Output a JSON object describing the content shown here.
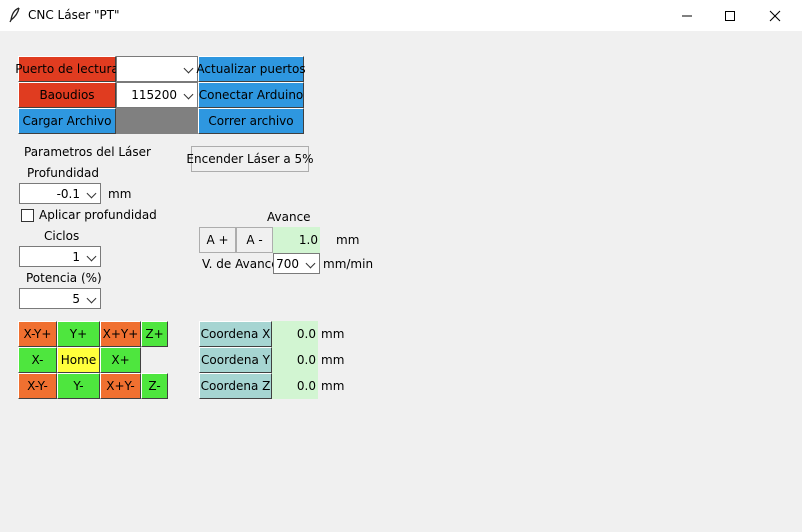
{
  "window": {
    "title": "CNC Láser \"PT\"",
    "icon": "feather-icon",
    "controls": [
      "minimize-icon",
      "maximize-icon",
      "close-icon"
    ]
  },
  "serial": {
    "port_label": "Puerto de lectura",
    "port_value": "",
    "baud_label": "Baoudios",
    "baud_value": "115200",
    "refresh_button": "Actualizar puertos",
    "connect_button": "Conectar Arduino",
    "load_file_button": "Cargar Archivo",
    "run_file_button": "Correr archivo"
  },
  "laser": {
    "params_title": "Parametros del Láser",
    "depth_label": "Profundidad",
    "depth_value": "-0.1",
    "depth_unit": "mm",
    "apply_depth_label": "Aplicar profundidad",
    "apply_depth_checked": false,
    "cycles_label": "Ciclos",
    "cycles_value": "1",
    "power_label": "Potencia (%)",
    "power_value": "5",
    "power_on_button": "Encender Láser a 5%"
  },
  "feed": {
    "title": "Avance",
    "increase_button": "A +",
    "decrease_button": "A -",
    "step_value": "1.0",
    "step_unit": "mm",
    "speed_label": "V. de Avance",
    "speed_value": "700",
    "speed_unit": "mm/min"
  },
  "jog": {
    "xm_yp": "X-Y+",
    "yp": "Y+",
    "xp_yp": "X+Y+",
    "zp": "Z+",
    "xm": "X-",
    "home": "Home",
    "xp": "X+",
    "xm_ym": "X-Y-",
    "ym": "Y-",
    "xp_ym": "X+Y-",
    "zm": "Z-"
  },
  "coords": {
    "x_label": "Coordena X",
    "x_value": "0.0",
    "y_label": "Coordena Y",
    "y_value": "0.0",
    "z_label": "Coordena Z",
    "z_value": "0.0",
    "unit": "mm"
  },
  "colors": {
    "red": "#e03c20",
    "blue": "#2e97e0",
    "orange": "#f07030",
    "green": "#4ee63e",
    "yellow": "#ffff3c",
    "teal": "#a6d5d2",
    "value_bg": "#d2f5d2"
  }
}
